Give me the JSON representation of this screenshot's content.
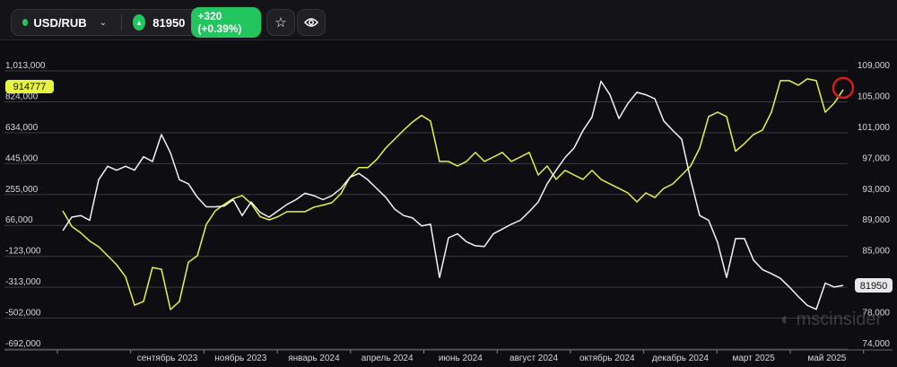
{
  "header": {
    "symbol": "USD/RUB",
    "price": "81950",
    "change": "+320 (+0.39%)",
    "icons": [
      "status-dot-icon",
      "chevron-down-icon",
      "arrow-up-icon",
      "star-icon",
      "eye-icon"
    ]
  },
  "colors": {
    "accent_green": "#22c55e",
    "yellow_series": "#e6f542",
    "white_series": "#f2f2f2",
    "annotation": "#d41c1c",
    "grid": "#3a3a42"
  },
  "watermark": "mscinsider",
  "chart_data": {
    "type": "line",
    "title": "",
    "x_ticks": [
      "сентябрь 2023",
      "ноябрь 2023",
      "январь 2024",
      "апрель 2024",
      "июнь 2024",
      "август 2024",
      "октябрь 2024",
      "декабрь 2024",
      "март 2025",
      "май 2025"
    ],
    "x_range_periods": [
      0,
      11.4
    ],
    "y_left": {
      "ticks": [
        "1,013,000",
        "824,000",
        "634,000",
        "445,000",
        "255,000",
        "66,000",
        "-123,000",
        "-313,000",
        "-502,000",
        "-692,000"
      ],
      "range": [
        -692000,
        1013000
      ]
    },
    "y_right": {
      "ticks": [
        "109,000",
        "105,000",
        "101,000",
        "97,000",
        "93,000",
        "89,000",
        "85,000",
        "78,000",
        "74,000"
      ],
      "range": [
        74000,
        109000
      ]
    },
    "grid": true,
    "series": [
      {
        "name": "yellow (left axis)",
        "axis": "left",
        "x_start": 0.073,
        "x_step": 0.1224,
        "last_value_label": "914777",
        "values": [
          155,
          60,
          20,
          -30,
          -65,
          -120,
          -175,
          -250,
          -423,
          -400,
          -192,
          -203,
          -450,
          -400,
          -160,
          -120,
          72,
          155,
          195,
          230,
          249,
          200,
          120,
          100,
          120,
          150,
          150,
          150,
          178,
          190,
          205,
          260,
          360,
          420,
          420,
          470,
          540,
          595,
          650,
          700,
          740,
          705,
          458,
          458,
          430,
          458,
          513,
          458,
          485,
          513,
          458,
          485,
          513,
          375,
          430,
          348,
          403,
          375,
          348,
          403,
          348,
          320,
          293,
          265,
          210,
          265,
          237,
          293,
          320,
          375,
          430,
          540,
          733,
          760,
          733,
          520,
          568,
          623,
          650,
          760,
          953,
          953,
          925,
          964,
          953,
          760,
          815,
          898
        ],
        "value_unit": "thousands"
      },
      {
        "name": "white USD/RUB (right axis)",
        "axis": "right",
        "x_start": 0.073,
        "x_step": 0.1224,
        "last_value_label": "81950",
        "values": [
          88900,
          90600,
          90800,
          90200,
          95300,
          97000,
          96500,
          97000,
          96500,
          98200,
          97600,
          101000,
          98700,
          95300,
          94800,
          93100,
          91900,
          91900,
          92000,
          92800,
          90800,
          92500,
          91200,
          90600,
          91400,
          92200,
          92800,
          93600,
          93300,
          92800,
          93300,
          94200,
          95600,
          96100,
          95300,
          94200,
          93100,
          91600,
          90800,
          90500,
          89500,
          89700,
          83000,
          88000,
          88500,
          87500,
          87000,
          86900,
          88500,
          89100,
          89700,
          90200,
          91300,
          92500,
          94800,
          96500,
          98100,
          99300,
          101500,
          103200,
          107700,
          106000,
          103000,
          104900,
          106300,
          106000,
          105500,
          102700,
          101500,
          100400,
          95300,
          90800,
          90200,
          87400,
          83000,
          87900,
          87900,
          85200,
          84000,
          83500,
          82900,
          81800,
          80600,
          79500,
          79000,
          82300,
          81800,
          82000
        ]
      }
    ],
    "annotations": [
      "red circle around latest yellow value"
    ]
  }
}
